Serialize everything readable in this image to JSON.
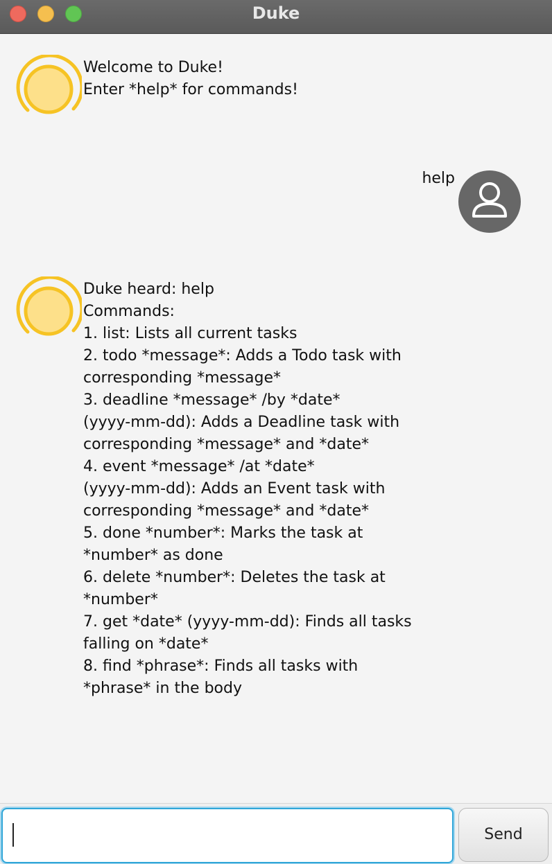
{
  "window": {
    "title": "Duke"
  },
  "messages": {
    "welcome": "Welcome to Duke!\nEnter *help* for commands!",
    "user_help": "help",
    "help_response": "Duke heard: help\nCommands:\n1. list: Lists all current tasks\n2. todo *message*: Adds a Todo task with\ncorresponding *message*\n3. deadline *message* /by *date*\n(yyyy-mm-dd): Adds a Deadline task with\ncorresponding *message* and *date*\n4. event *message* /at *date*\n(yyyy-mm-dd): Adds an Event task with\ncorresponding *message* and *date*\n5. done *number*: Marks the task at\n*number* as done\n6. delete *number*: Deletes the task at\n*number*\n7. get *date* (yyyy-mm-dd): Finds all tasks\nfalling on *date*\n8. find *phrase*: Finds all tasks with\n*phrase* in the body"
  },
  "input": {
    "value": "",
    "placeholder": ""
  },
  "send_button": {
    "label": "Send"
  },
  "icons": {
    "duke_avatar": "duke-sun-avatar-icon",
    "user_avatar": "user-avatar-icon"
  },
  "colors": {
    "duke_ring": "#f6c324",
    "duke_fill": "#fde08a",
    "user_avatar_bg": "#676767",
    "input_focus": "#2fa6d8"
  }
}
